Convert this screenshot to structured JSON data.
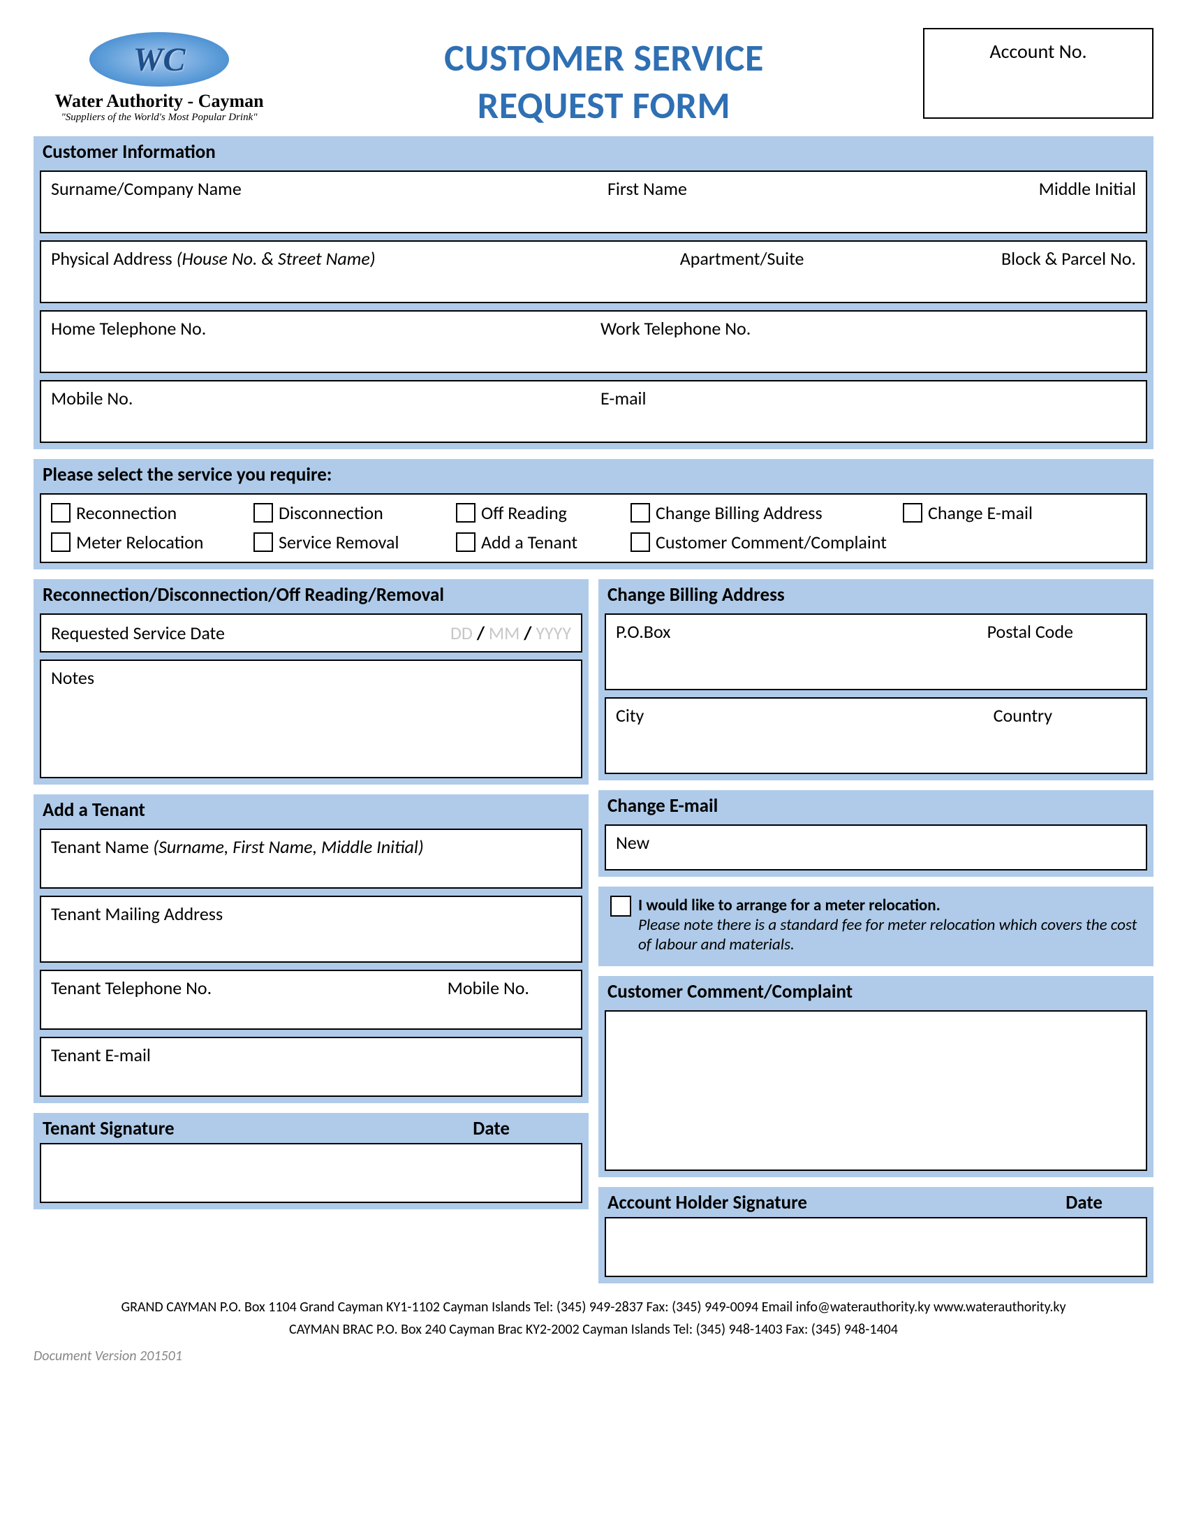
{
  "logo": {
    "initials": "WC",
    "name": "Water Authority - Cayman",
    "tagline": "\"Suppliers of the World's Most Popular Drink\""
  },
  "title_line1": "CUSTOMER SERVICE",
  "title_line2": "REQUEST FORM",
  "account_label": "Account No.",
  "customer_info": {
    "heading": "Customer Information",
    "surname": "Surname/Company Name",
    "first_name": "First Name",
    "middle": "Middle Initial",
    "phys_addr": "Physical Address",
    "phys_addr_hint": "(House No. & Street Name)",
    "apt": "Apartment/Suite",
    "block": "Block & Parcel No.",
    "home_tel": "Home Telephone No.",
    "work_tel": "Work Telephone No.",
    "mobile": "Mobile No.",
    "email": "E-mail"
  },
  "service_select": {
    "heading": "Please select the service you require:",
    "options_row1": [
      "Reconnection",
      "Disconnection",
      "Off Reading",
      "Change Billing Address",
      "Change E-mail"
    ],
    "options_row2": [
      "Meter Relocation",
      "Service Removal",
      "Add a Tenant",
      "Customer Comment/Complaint"
    ]
  },
  "reconn": {
    "heading": "Reconnection/Disconnection/Off Reading/Removal",
    "req_date": "Requested Service Date",
    "date_dd": "DD",
    "date_mm": "MM",
    "date_yyyy": "YYYY",
    "notes": "Notes"
  },
  "tenant": {
    "heading": "Add a Tenant",
    "name": "Tenant Name",
    "name_hint": "(Surname, First Name, Middle Initial)",
    "mail": "Tenant Mailing Address",
    "tel": "Tenant Telephone No.",
    "mobile": "Mobile No.",
    "email": "Tenant E-mail"
  },
  "billing": {
    "heading": "Change Billing Address",
    "pobox": "P.O.Box",
    "postal": "Postal Code",
    "city": "City",
    "country": "Country"
  },
  "change_email": {
    "heading": "Change E-mail",
    "new": "New"
  },
  "reloc": {
    "bold": "I would like to arrange for a meter relocation.",
    "note": "Please note there is a standard fee for meter relocation which covers the cost of labour and materials."
  },
  "complaint": {
    "heading": "Customer Comment/Complaint"
  },
  "signatures": {
    "tenant_sig": "Tenant Signature",
    "account_sig": "Account Holder Signature",
    "date": "Date"
  },
  "footer": {
    "line1": "GRAND CAYMAN P.O. Box 1104 Grand Cayman KY1-1102 Cayman Islands Tel: (345) 949-2837 Fax: (345) 949-0094 Email info@waterauthority.ky www.waterauthority.ky",
    "line2": "CAYMAN BRAC P.O. Box 240 Cayman Brac KY2-2002 Cayman Islands Tel: (345) 948-1403 Fax: (345) 948-1404",
    "version": "Document Version 201501"
  }
}
